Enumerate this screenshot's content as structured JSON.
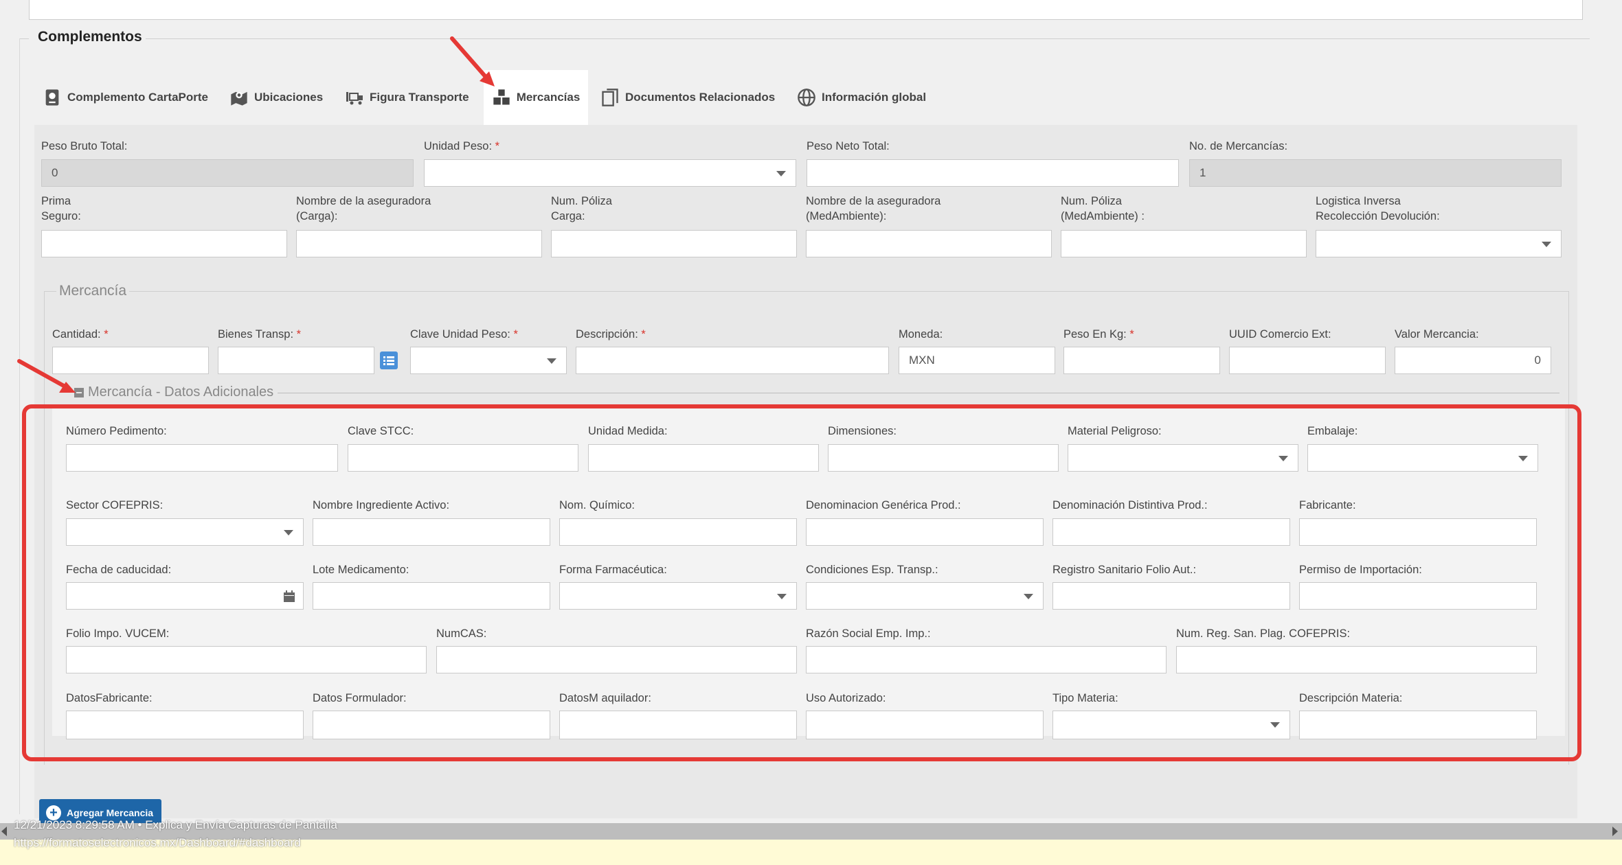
{
  "section": {
    "title": "Complementos"
  },
  "tabs": [
    {
      "label": "Complemento CartaPorte",
      "icon": "passport-icon"
    },
    {
      "label": "Ubicaciones",
      "icon": "map-pin-icon"
    },
    {
      "label": "Figura Transporte",
      "icon": "truck-icon"
    },
    {
      "label": "Mercancías",
      "icon": "boxes-icon",
      "active": true
    },
    {
      "label": "Documentos Relacionados",
      "icon": "documents-icon"
    },
    {
      "label": "Información global",
      "icon": "globe-icon"
    }
  ],
  "summary": {
    "peso_bruto": {
      "label": "Peso Bruto Total:",
      "value": "0"
    },
    "unidad_peso": {
      "label": "Unidad Peso:",
      "req": "*",
      "value": ""
    },
    "peso_neto": {
      "label": "Peso Neto Total:",
      "value": ""
    },
    "num_mercancias": {
      "label": "No. de Mercancías:",
      "value": "1"
    }
  },
  "seguros": {
    "prima": {
      "l1": "Prima",
      "l2": "Seguro:"
    },
    "aseg_carga": {
      "l1": "Nombre de la aseguradora",
      "l2": "(Carga):"
    },
    "poliza_carga": {
      "l1": "Num. Póliza",
      "l2": "Carga:"
    },
    "aseg_med": {
      "l1": "Nombre de la aseguradora",
      "l2": "(MedAmbiente):"
    },
    "poliza_med": {
      "l1": "Num. Póliza",
      "l2": "(MedAmbiente) :"
    },
    "logistica": {
      "l1": "Logistica Inversa",
      "l2": "Recolección Devolución:"
    }
  },
  "mercancia": {
    "title": "Mercancía",
    "cantidad": "Cantidad:",
    "bienes": "Bienes Transp:",
    "clave_unidad": "Clave Unidad Peso:",
    "descripcion": "Descripción:",
    "moneda": "Moneda:",
    "moneda_value": "MXN",
    "peso_kg": "Peso En Kg:",
    "uuid": "UUID Comercio Ext:",
    "valor": "Valor Mercancia:",
    "valor_value": "0",
    "req": "*"
  },
  "datos_adicionales": {
    "title": "Mercancía - Datos Adicionales",
    "row1": [
      "Número Pedimento:",
      "Clave STCC:",
      "Unidad Medida:",
      "Dimensiones:",
      "Material Peligroso:",
      "Embalaje:"
    ],
    "row2": [
      "Sector COFEPRIS:",
      "Nombre Ingrediente Activo:",
      "Nom. Químico:",
      "Denominacion Genérica Prod.:",
      "Denominación Distintiva Prod.:",
      "Fabricante:"
    ],
    "row3": [
      "Fecha de caducidad:",
      "Lote Medicamento:",
      "Forma Farmacéutica:",
      "Condiciones Esp. Transp.:",
      "Registro Sanitario Folio Aut.:",
      "Permiso de Importación:"
    ],
    "row4": [
      "Folio Impo. VUCEM:",
      "NumCAS:",
      "Razón Social Emp. Imp.:",
      "Num. Reg. San. Plag. COFEPRIS:"
    ],
    "row5": [
      "DatosFabricante:",
      "Datos Formulador:",
      "DatosM aquilador:",
      "Uso Autorizado:",
      "Tipo Materia:",
      "Descripción Materia:"
    ]
  },
  "buttons": {
    "add_mercancia": "Agregar Mercancia"
  },
  "status": {
    "text": "12/21/2023 8:29:58 AM • Explica y Envía Capturas de Pantalla",
    "url": "https://formatoselectronicos.mx/Dashboard/#dashboard"
  },
  "colors": {
    "accent_red": "#e53935",
    "button_blue": "#1e66a8"
  }
}
